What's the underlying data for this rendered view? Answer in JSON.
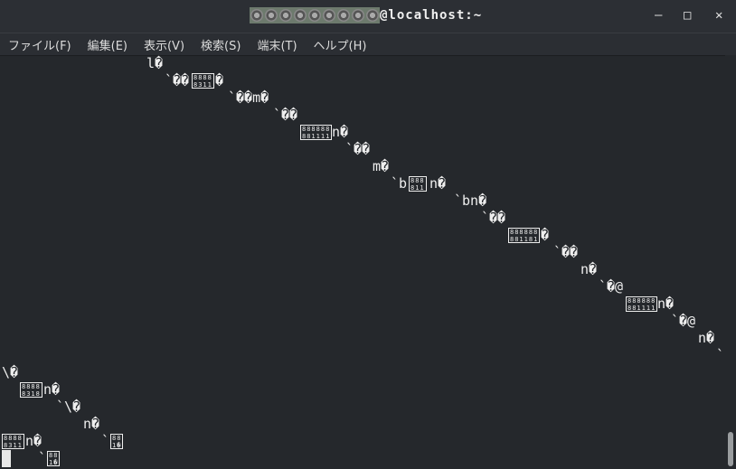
{
  "window": {
    "title": "@localhost:~",
    "minimize": "–",
    "maximize": "□",
    "close": "✕"
  },
  "menu": [
    "ファイル(F)",
    "編集(E)",
    "表示(V)",
    "検索(S)",
    "端末(T)",
    "ヘルプ(H)"
  ],
  "terminal": {
    "rows": [
      [
        {
          "col": 16,
          "text": "l�"
        }
      ],
      [
        {
          "col": 18,
          "text": "`��"
        },
        {
          "col": 21,
          "box": [
            "8888",
            "8311"
          ]
        },
        {
          "col": 23.6,
          "text": "�"
        }
      ],
      [
        {
          "col": 25,
          "text": "`��m�"
        }
      ],
      [
        {
          "col": 30,
          "text": "`��"
        }
      ],
      [
        {
          "col": 33,
          "box": [
            "888888",
            "881111"
          ]
        },
        {
          "col": 36.5,
          "text": "n�"
        }
      ],
      [
        {
          "col": 38,
          "text": "`��"
        }
      ],
      [
        {
          "col": 41,
          "text": "m�"
        }
      ],
      [
        {
          "col": 43,
          "text": "`b"
        },
        {
          "col": 45,
          "box": [
            "888",
            "811"
          ]
        },
        {
          "col": 47.3,
          "text": "n�"
        }
      ],
      [
        {
          "col": 50,
          "text": "`bn�"
        }
      ],
      [
        {
          "col": 53,
          "text": "`��"
        }
      ],
      [
        {
          "col": 56,
          "box": [
            "888888",
            "881181"
          ]
        },
        {
          "col": 59.6,
          "text": "�"
        }
      ],
      [
        {
          "col": 61,
          "text": "`��"
        }
      ],
      [
        {
          "col": 64,
          "text": "n�"
        }
      ],
      [
        {
          "col": 66,
          "text": "`�@"
        }
      ],
      [
        {
          "col": 69,
          "box": [
            "888888",
            "881111"
          ]
        },
        {
          "col": 72.5,
          "text": "n�"
        }
      ],
      [
        {
          "col": 74,
          "text": "`�@"
        }
      ],
      [
        {
          "col": 77,
          "text": "n�"
        }
      ],
      [
        {
          "col": 79,
          "text": "`"
        }
      ],
      [
        {
          "col": 0,
          "text": "\\�"
        }
      ],
      [
        {
          "col": 2,
          "box": [
            "8888",
            "8318"
          ]
        },
        {
          "col": 4.6,
          "text": "n�"
        }
      ],
      [
        {
          "col": 6,
          "text": "`\\�"
        }
      ],
      [
        {
          "col": 9,
          "text": "n�"
        }
      ],
      [
        {
          "col": 0,
          "box": [
            "8888",
            "8311"
          ]
        },
        {
          "col": 2.6,
          "text": "n�"
        },
        {
          "col": 11,
          "text": "`"
        },
        {
          "col": 12,
          "box": [
            "88",
            "1�"
          ]
        }
      ],
      [
        {
          "col": 4,
          "text": "`"
        },
        {
          "col": 5,
          "box": [
            "88",
            "1�"
          ]
        }
      ]
    ]
  },
  "scrollbar": {
    "position_percent": 100
  }
}
